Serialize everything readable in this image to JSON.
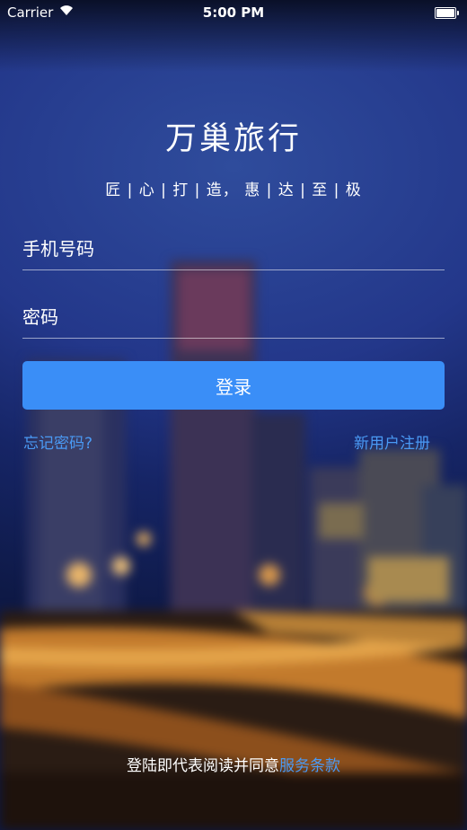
{
  "status_bar": {
    "carrier": "Carrier",
    "time": "5:00 PM",
    "wifi_icon": "wifi-icon",
    "battery_icon": "battery-icon"
  },
  "app": {
    "title": "万巢旅行",
    "slogan": "匠 | 心 | 打 | 造， 惠 | 达 | 至 | 极"
  },
  "login_form": {
    "phone_placeholder": "手机号码",
    "phone_value": "",
    "password_placeholder": "密码",
    "password_value": "",
    "login_label": "登录",
    "forgot_label": "忘记密码?",
    "register_label": "新用户注册"
  },
  "footer": {
    "agreement_text": "登陆即代表阅读并同意",
    "terms_link": "服务条款"
  },
  "colors": {
    "accent": "#3a8ef7",
    "link": "#4a9af5",
    "background_top": "#2f4c9c"
  }
}
